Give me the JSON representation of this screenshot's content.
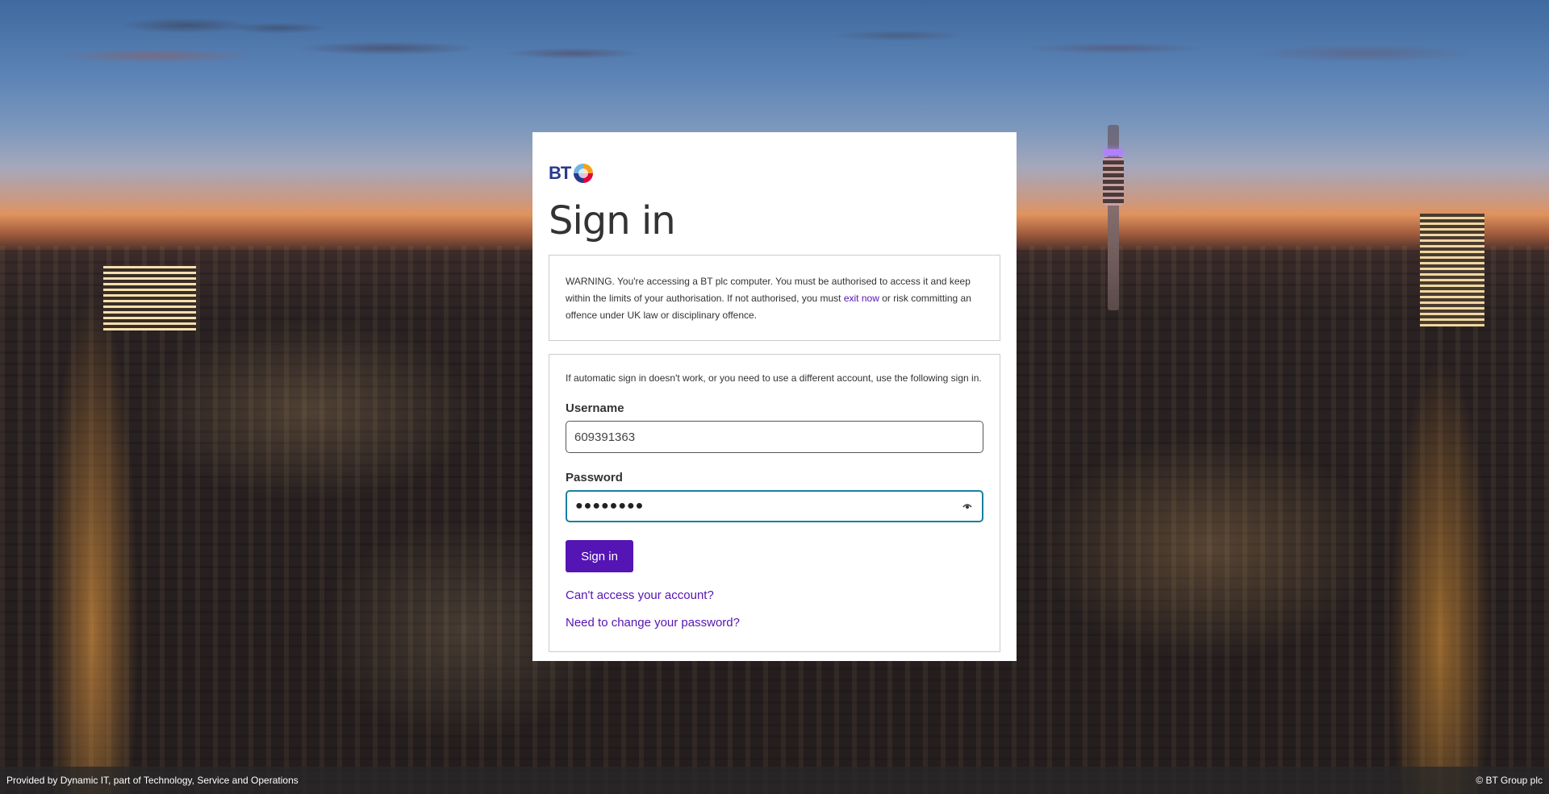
{
  "brand": {
    "logo_text": "BT",
    "logo_icon": "bt-globe-icon"
  },
  "page": {
    "title": "Sign in"
  },
  "warning": {
    "text_before": "WARNING. You're accessing a BT plc computer. You must be authorised to access it and keep within the limits of your authorisation. If not authorised, you must ",
    "link_text": "exit now",
    "text_after": " or risk committing an offence under UK law or disciplinary offence."
  },
  "form": {
    "info": "If automatic sign in doesn't work, or you need to use a different account, use the following sign in.",
    "username_label": "Username",
    "username_value": "609391363",
    "password_label": "Password",
    "password_mask": "●●●●●●●●",
    "password_toggle_icon": "eye-icon",
    "submit_label": "Sign in",
    "link_cant_access": "Can't access your account?",
    "link_change_password": "Need to change your password?"
  },
  "footer": {
    "left": "Provided by Dynamic IT, part of Technology, Service and Operations",
    "right": "© BT Group plc"
  },
  "colors": {
    "accent": "#5514b4",
    "focus_border": "#1a7fa0",
    "footer_bg": "#282828"
  }
}
